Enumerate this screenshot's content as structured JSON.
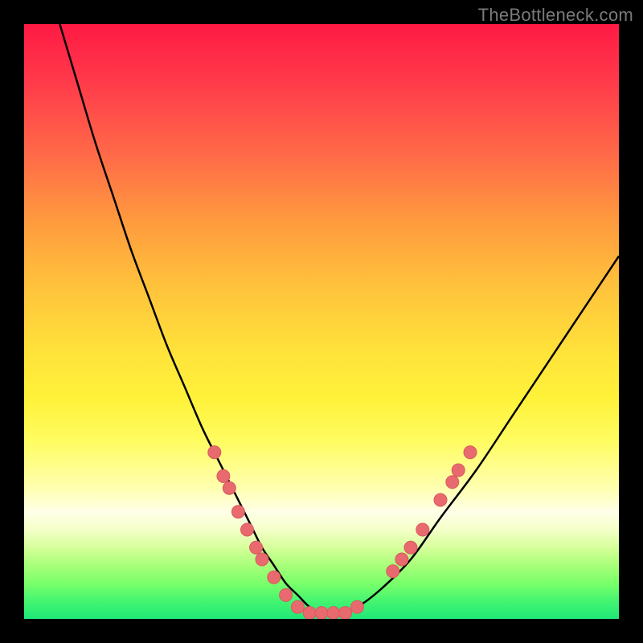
{
  "watermark": "TheBottleneck.com",
  "colors": {
    "curve_stroke": "#000000",
    "marker_fill": "#e96a6e",
    "marker_stroke": "#d85a5e"
  },
  "chart_data": {
    "type": "line",
    "title": "",
    "xlabel": "",
    "ylabel": "",
    "xlim": [
      0,
      100
    ],
    "ylim": [
      0,
      100
    ],
    "series": [
      {
        "name": "bottleneck-curve",
        "x": [
          6,
          9,
          12,
          15,
          18,
          21,
          24,
          27,
          30,
          33,
          36,
          38,
          40,
          42,
          44,
          46,
          48,
          50,
          53,
          56,
          60,
          65,
          70,
          76,
          82,
          88,
          94,
          100
        ],
        "y": [
          100,
          90,
          80,
          71,
          62,
          54,
          46,
          39,
          32,
          26,
          20,
          16,
          12,
          9,
          6,
          4,
          2,
          1,
          1,
          2,
          5,
          10,
          17,
          25,
          34,
          43,
          52,
          61
        ]
      }
    ],
    "markers": {
      "name": "highlighted-points",
      "points": [
        {
          "x": 32,
          "y": 28
        },
        {
          "x": 33.5,
          "y": 24
        },
        {
          "x": 34.5,
          "y": 22
        },
        {
          "x": 36,
          "y": 18
        },
        {
          "x": 37.5,
          "y": 15
        },
        {
          "x": 39,
          "y": 12
        },
        {
          "x": 40,
          "y": 10
        },
        {
          "x": 42,
          "y": 7
        },
        {
          "x": 44,
          "y": 4
        },
        {
          "x": 46,
          "y": 2
        },
        {
          "x": 48,
          "y": 1
        },
        {
          "x": 50,
          "y": 1
        },
        {
          "x": 52,
          "y": 1
        },
        {
          "x": 54,
          "y": 1
        },
        {
          "x": 56,
          "y": 2
        },
        {
          "x": 62,
          "y": 8
        },
        {
          "x": 63.5,
          "y": 10
        },
        {
          "x": 65,
          "y": 12
        },
        {
          "x": 67,
          "y": 15
        },
        {
          "x": 70,
          "y": 20
        },
        {
          "x": 72,
          "y": 23
        },
        {
          "x": 73,
          "y": 25
        },
        {
          "x": 75,
          "y": 28
        }
      ]
    }
  }
}
